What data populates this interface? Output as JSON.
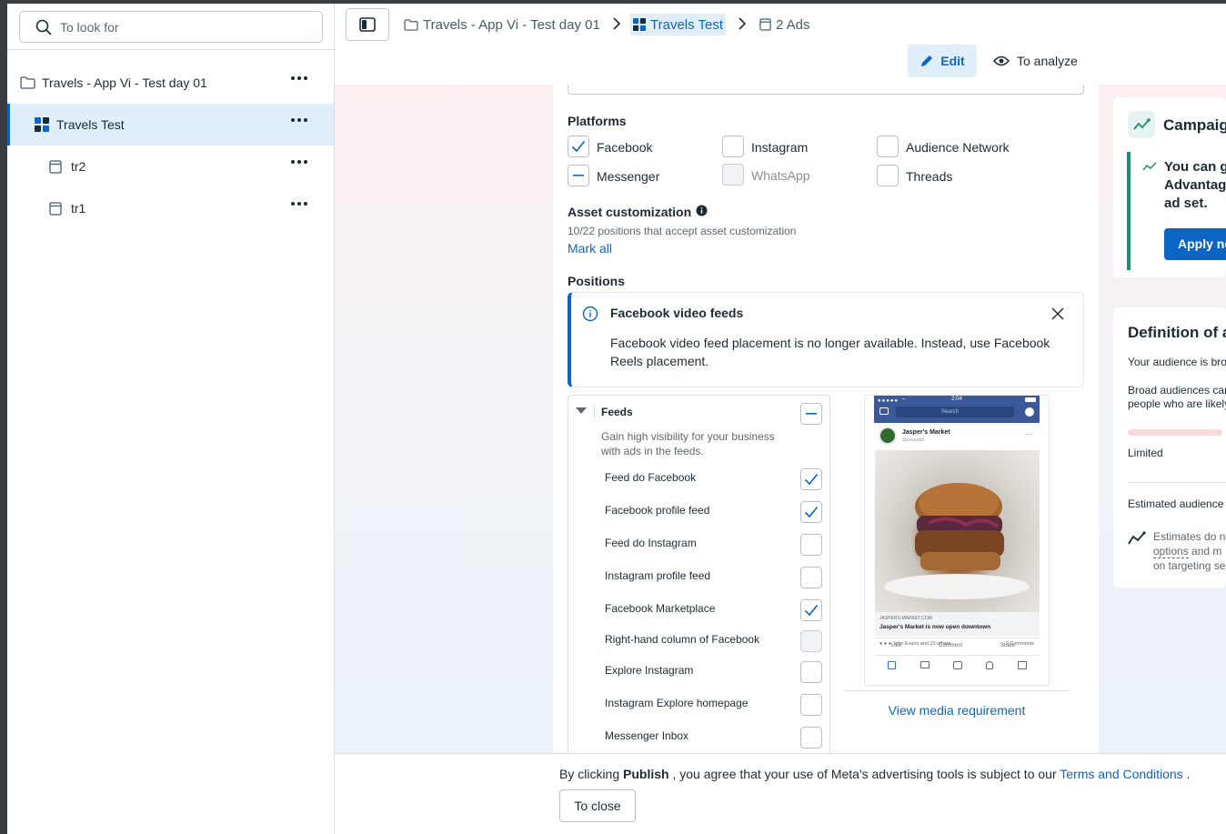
{
  "sidebar": {
    "search_placeholder": "To look for",
    "items": [
      {
        "label": "Travels - App Vi - Test day 01",
        "type": "campaign"
      },
      {
        "label": "Travels Test",
        "type": "adset",
        "selected": true
      },
      {
        "label": "tr2",
        "type": "ad"
      },
      {
        "label": "tr1",
        "type": "ad"
      }
    ]
  },
  "breadcrumb": {
    "campaign": "Travels - App Vi - Test day 01",
    "adset": "Travels Test",
    "ads": "2 Ads"
  },
  "header": {
    "edit_label": "Edit",
    "analyze_label": "To analyze"
  },
  "platforms": {
    "title": "Platforms",
    "options": [
      {
        "label": "Facebook",
        "state": "checked"
      },
      {
        "label": "Instagram",
        "state": "unchecked"
      },
      {
        "label": "Audience Network",
        "state": "unchecked"
      },
      {
        "label": "Messenger",
        "state": "indeterminate"
      },
      {
        "label": "WhatsApp",
        "state": "disabled"
      },
      {
        "label": "Threads",
        "state": "unchecked"
      }
    ]
  },
  "asset_customization": {
    "title": "Asset customization",
    "subtitle": "10/22 positions that accept asset customization",
    "mark_all": "Mark all"
  },
  "positions": {
    "title": "Positions",
    "notice_title": "Facebook video feeds",
    "notice_body": "Facebook video feed placement is no longer available. Instead, use Facebook Reels placement.",
    "group_title": "Feeds",
    "group_desc": "Gain high visibility for your business with ads in the feeds.",
    "items": [
      {
        "label": "Feed do Facebook",
        "state": "checked"
      },
      {
        "label": "Facebook profile feed",
        "state": "checked"
      },
      {
        "label": "Feed do Instagram",
        "state": "unchecked"
      },
      {
        "label": "Instagram profile feed",
        "state": "unchecked"
      },
      {
        "label": "Facebook Marketplace",
        "state": "checked"
      },
      {
        "label": "Right-hand column of Facebook",
        "state": "disabled"
      },
      {
        "label": "Explore Instagram",
        "state": "unchecked"
      },
      {
        "label": "Instagram Explore homepage",
        "state": "unchecked"
      },
      {
        "label": "Messenger Inbox",
        "state": "unchecked"
      }
    ],
    "view_media": "View media requirement"
  },
  "preview": {
    "time": "2:04",
    "search": "Search",
    "page_name": "Jasper's Market",
    "sponsored": "Sponsored",
    "domain": "JASPERS-MARKET.COM",
    "headline": "Jasper's Market is now open downtown",
    "reactions": "John Evans and 23 others",
    "comments": "2 Comments",
    "like": "Like",
    "comment": "Comment",
    "share": "Share"
  },
  "right_panel": {
    "campaign_card_title": "Campaign",
    "campaign_card_text_1": "You can ge",
    "campaign_card_text_2": "Advantag",
    "campaign_card_text_3": "ad set.",
    "apply_button": "Apply no",
    "audience_title": "Definition of au",
    "audience_line_1": "Your audience is bro",
    "audience_line_2": "Broad audiences car",
    "audience_line_3": "people who are likely",
    "audience_scale": "Limited",
    "estimated_label": "Estimated audience",
    "estimate_note_1": "Estimates do n",
    "estimate_note_2a": "options",
    "estimate_note_2b": "and m",
    "estimate_note_3": "on targeting se"
  },
  "footer": {
    "text_before": "By clicking ",
    "text_bold": "Publish",
    "text_middle": " , you agree that your use of Meta's advertising tools is subject to our ",
    "terms_link": "Terms and Conditions",
    "text_after": " .",
    "close_label": "To close"
  },
  "colors": {
    "accent": "#0a66c2",
    "selected_bg": "#e0eef9",
    "text": "#1c2b33"
  }
}
